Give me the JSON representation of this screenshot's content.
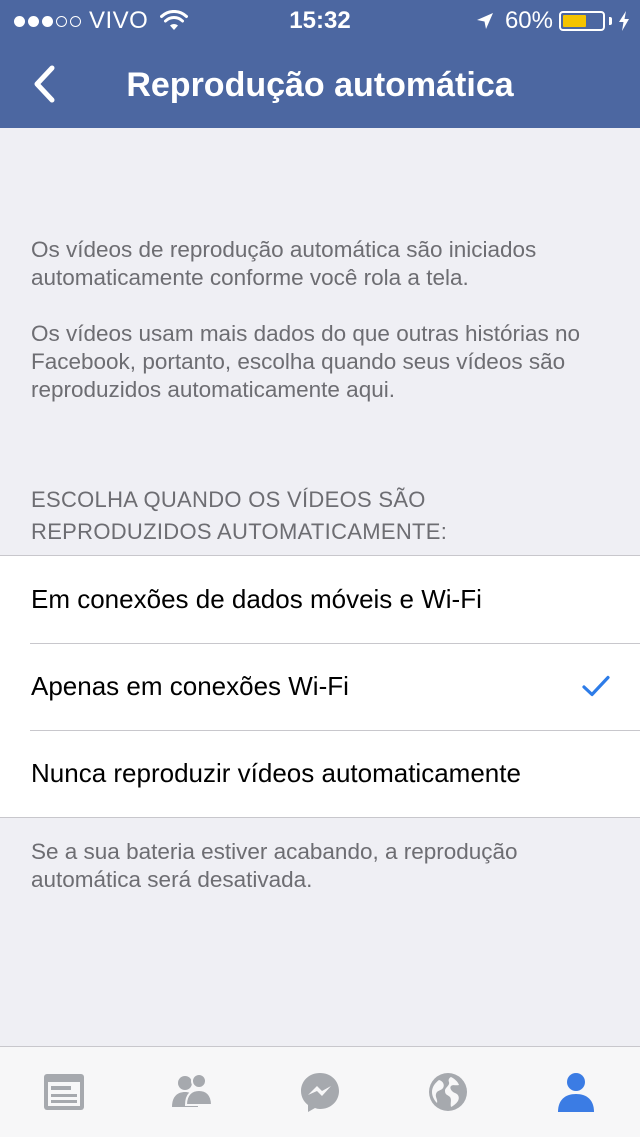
{
  "status_bar": {
    "carrier": "VIVO",
    "time": "15:32",
    "battery_percent": "60%",
    "battery_level": 0.6,
    "signal_bars_filled": 3,
    "signal_bars_total": 5
  },
  "nav": {
    "title": "Reprodução automática",
    "back_icon": "chevron-left-icon"
  },
  "description": {
    "paragraph1": "Os vídeos de reprodução automática são iniciados automaticamente conforme você rola a tela.",
    "paragraph2": "Os vídeos usam mais dados do que outras histórias no Facebook, portanto, escolha quando seus vídeos são reproduzidos automaticamente aqui."
  },
  "section": {
    "header": "ESCOLHA QUANDO OS VÍDEOS SÃO REPRODUZIDOS AUTOMATICAMENTE:"
  },
  "options": [
    {
      "label": "Em conexões de dados móveis e Wi-Fi",
      "selected": false
    },
    {
      "label": "Apenas em conexões Wi-Fi",
      "selected": true
    },
    {
      "label": "Nunca reproduzir vídeos automaticamente",
      "selected": false
    }
  ],
  "footer_note": "Se a sua bateria estiver acabando, a reprodução automática será desativada.",
  "tab_bar": {
    "tabs": [
      {
        "icon": "news-feed-icon",
        "active": false
      },
      {
        "icon": "friends-icon",
        "active": false
      },
      {
        "icon": "messenger-icon",
        "active": false
      },
      {
        "icon": "globe-icon",
        "active": false
      },
      {
        "icon": "profile-icon",
        "active": true
      }
    ]
  },
  "colors": {
    "brand": "#4c67a1",
    "background": "#efeff4",
    "accent": "#2d7ce8",
    "battery": "#f5c400",
    "tab_inactive": "#a6a9ae",
    "tab_active": "#3b7ce4"
  }
}
